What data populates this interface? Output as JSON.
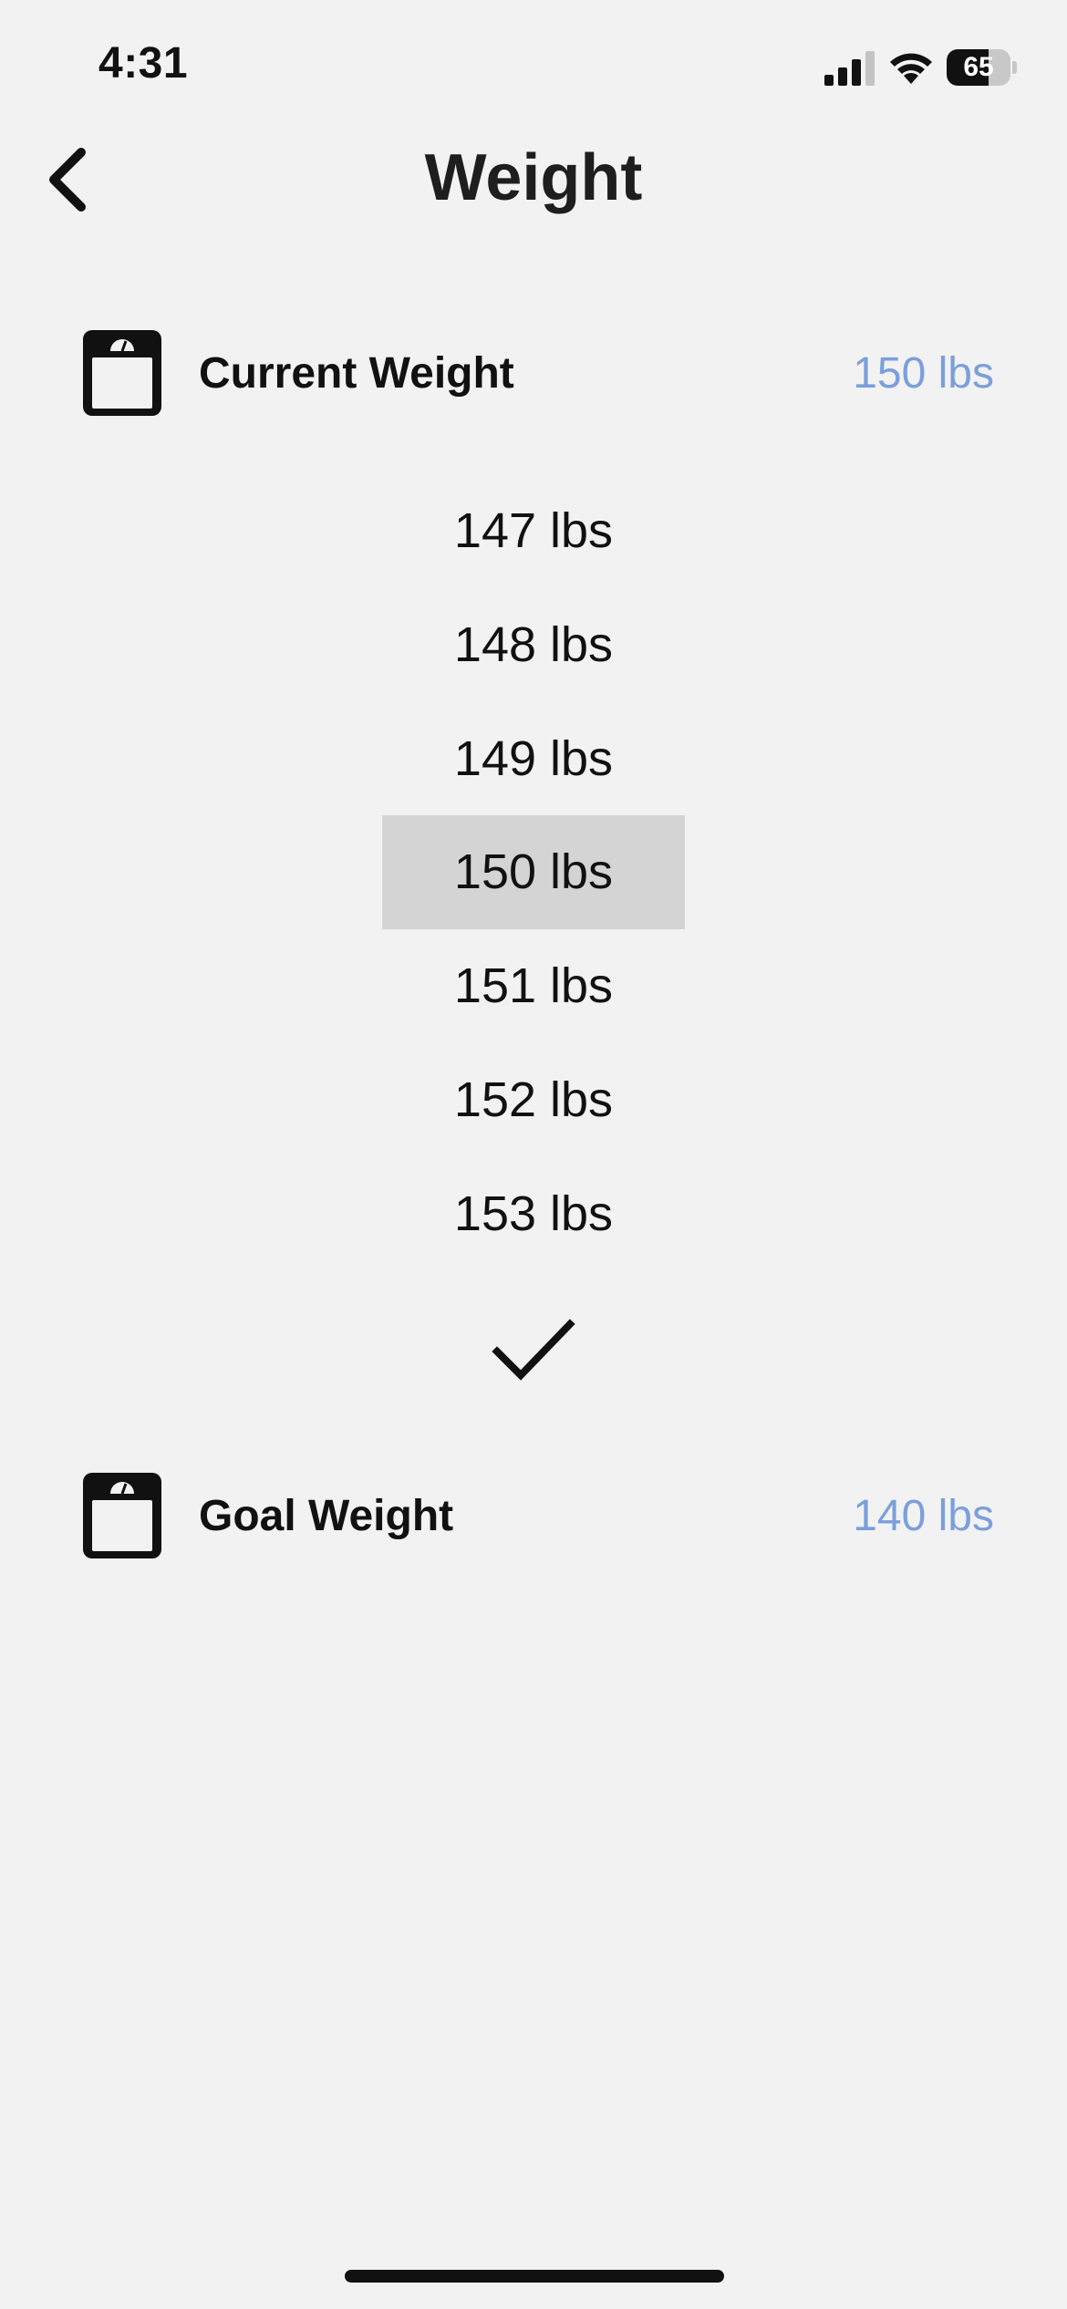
{
  "status_bar": {
    "time": "4:31",
    "battery_level": "65",
    "battery_fraction": 0.65,
    "signal_bars": 3,
    "signal_bars_total": 4
  },
  "header": {
    "title": "Weight",
    "back_icon": "chevron-left-icon"
  },
  "current_weight": {
    "icon": "scale-icon",
    "label": "Current Weight",
    "value": "150 lbs"
  },
  "picker": {
    "options": [
      "147 lbs",
      "148 lbs",
      "149 lbs",
      "150 lbs",
      "151 lbs",
      "152 lbs",
      "153 lbs"
    ],
    "selected_index": 3,
    "confirm_icon": "checkmark-icon"
  },
  "goal_weight": {
    "icon": "scale-icon",
    "label": "Goal Weight",
    "value": "140 lbs"
  },
  "colors": {
    "background": "#f2f2f2",
    "accent_value": "#7b9fdc",
    "selected_highlight": "#d4d4d4",
    "text": "#111111"
  }
}
